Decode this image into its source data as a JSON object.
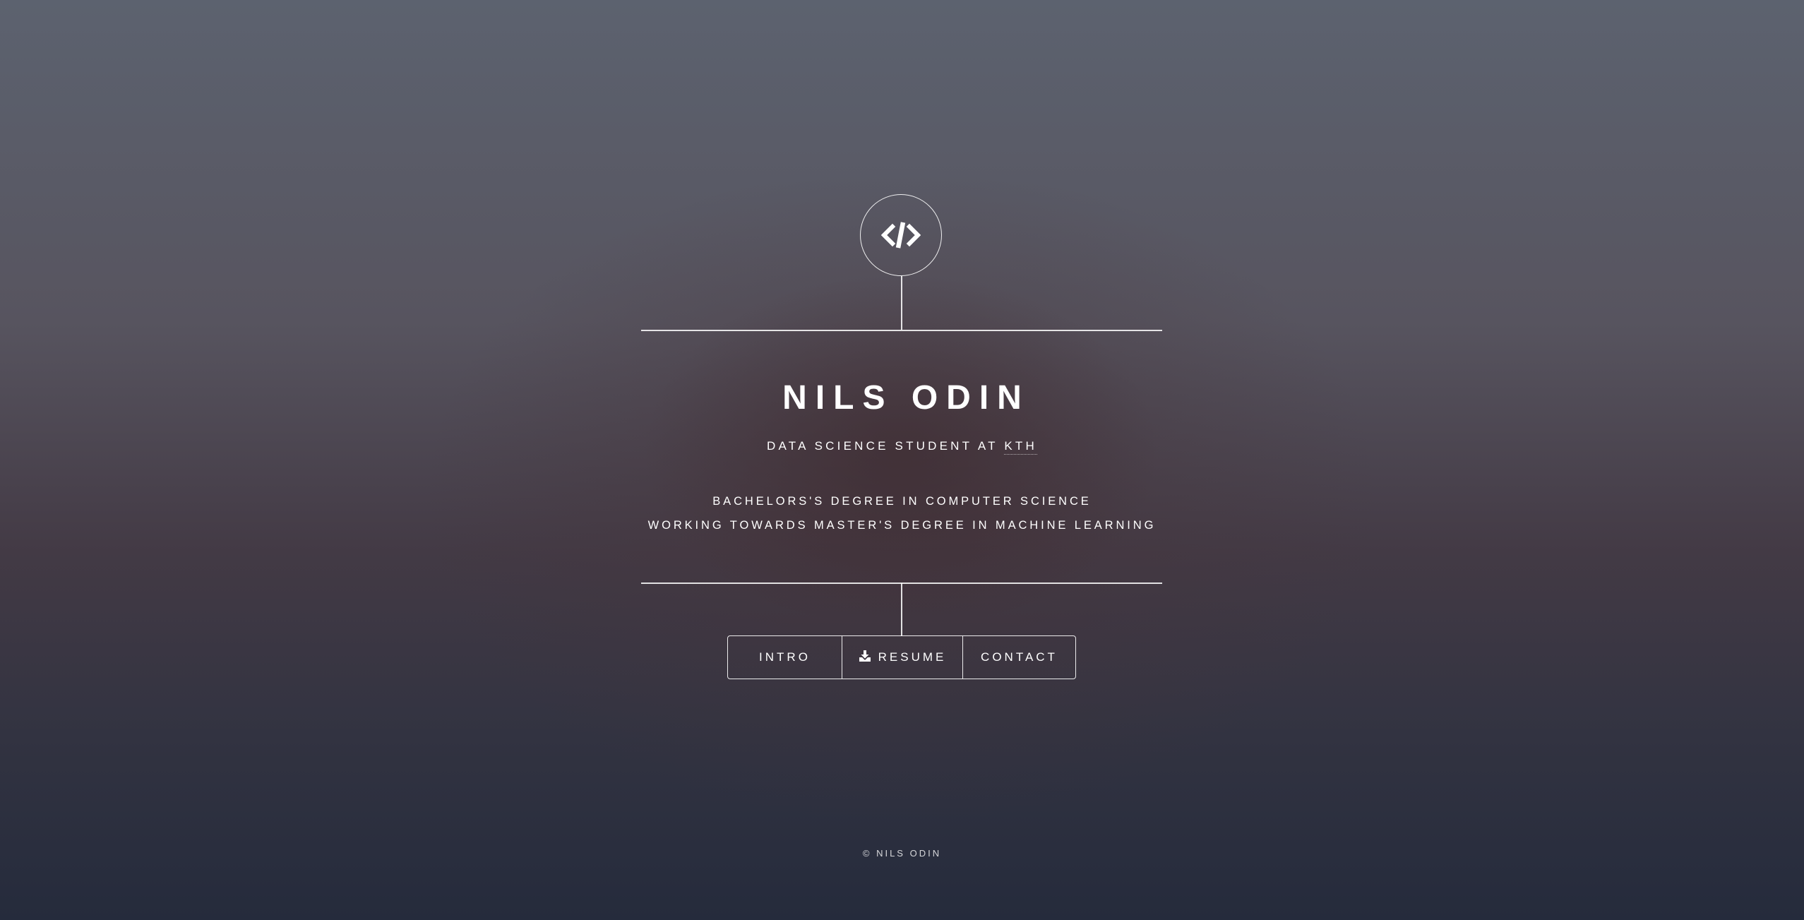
{
  "header": {
    "icon": "code-icon",
    "name": "NILS ODIN",
    "subtitle_prefix": "DATA SCIENCE STUDENT AT ",
    "subtitle_link": "KTH",
    "description_line1": "BACHELORS'S DEGREE IN COMPUTER SCIENCE",
    "description_line2": "WORKING TOWARDS MASTER'S DEGREE IN MACHINE LEARNING"
  },
  "nav": {
    "intro_label": "INTRO",
    "resume_icon": "download-icon",
    "resume_label": "RESUME",
    "contact_label": "CONTACT"
  },
  "footer": {
    "copyright": "© NILS ODIN"
  },
  "colors": {
    "text": "#ffffff",
    "background_top": "#5c626f",
    "background_bottom": "#252b3c"
  }
}
